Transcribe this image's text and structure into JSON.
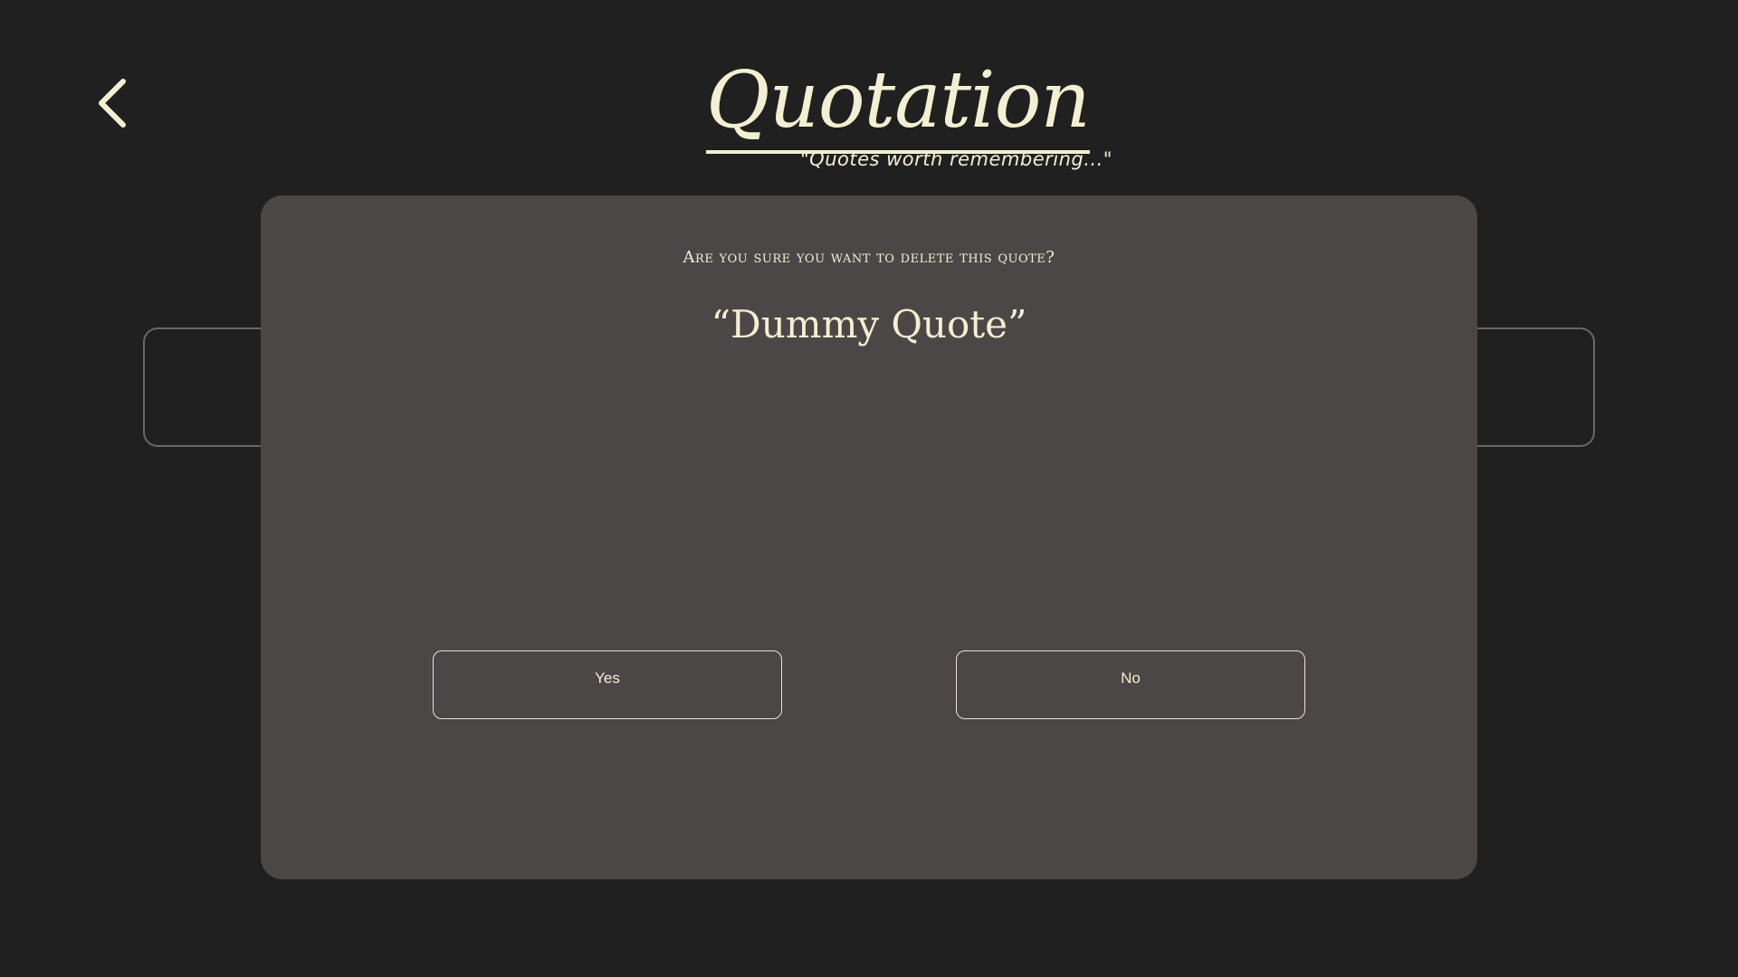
{
  "header": {
    "logo_title": "Quotation",
    "tagline": "\"Quotes worth remembering...\"",
    "back_icon": "chevron-left-icon"
  },
  "dialog": {
    "question": "Are you sure you want to delete this quote?",
    "quote": "“Dummy Quote”",
    "yes_label": "Yes",
    "no_label": "No"
  },
  "colors": {
    "background": "#202020",
    "modal": "#4c4747",
    "text": "#f3efd2",
    "card_border": "#6b6666"
  }
}
